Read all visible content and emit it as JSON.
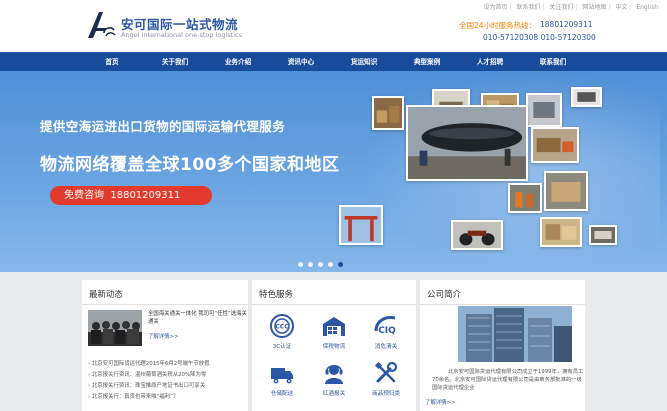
{
  "header": {
    "brand_cn": "安可国际一站式物流",
    "brand_en": "Angel international one-stop logistics",
    "top_links": [
      "设为首页",
      "联系我们",
      "关注我们",
      "网站地图",
      "中文",
      "English"
    ],
    "hotline_label": "全国24小时服务热线：",
    "hotline_mobile": "18801209311",
    "hotline_phones": "010-57120308   010-57120300"
  },
  "nav": {
    "items": [
      "首页",
      "关于我们",
      "业务介绍",
      "资讯中心",
      "货运知识",
      "典型案例",
      "人才招聘",
      "联系我们"
    ]
  },
  "banner": {
    "line1": "提供空海运进出口货物的国际运输代理服务",
    "line2": "物流网络覆盖全球100多个国家和地区",
    "consult_label": "免费咨询",
    "consult_phone": "18801209311",
    "active_slide": 5,
    "slide_count": 5
  },
  "news": {
    "title": "最新动态",
    "featured_title": "全国海关通关一体化 我司可“任性”选海关通关",
    "more": "了解详情>>",
    "items": [
      "北京安可国际货运代理2015年6月2号端午节放假",
      "北京报关行资讯：温州葡萄酒关税从20%降为零",
      "北京报关行资讯：珠宝推原产地证书出口可享关",
      "北京报关行：真货也带来唯“福利”？"
    ]
  },
  "services": {
    "title": "特色服务",
    "items": [
      {
        "label": "3C认证",
        "icon": "3c-certification-icon"
      },
      {
        "label": "保税物流",
        "icon": "bonded-warehouse-icon"
      },
      {
        "label": "消危清关",
        "icon": "ciq-clearance-icon"
      },
      {
        "label": "仓储配送",
        "icon": "delivery-truck-icon"
      },
      {
        "label": "红酒报关",
        "icon": "customer-service-icon"
      },
      {
        "label": "商品预归类",
        "icon": "tools-icon"
      }
    ]
  },
  "about": {
    "title": "公司简介",
    "text": "北京安可国际货运代理有限公司成立于1999年，拥有员工70余名。北京安可国际货运代理有限公司是由商务部批准的一级国际货运代理企业",
    "more": "了解详情>>"
  },
  "colors": {
    "nav_blue": "#194b9b",
    "brand_blue": "#2c56a6",
    "accent_orange": "#ff7e00",
    "consult_red": "#e23b2d"
  }
}
